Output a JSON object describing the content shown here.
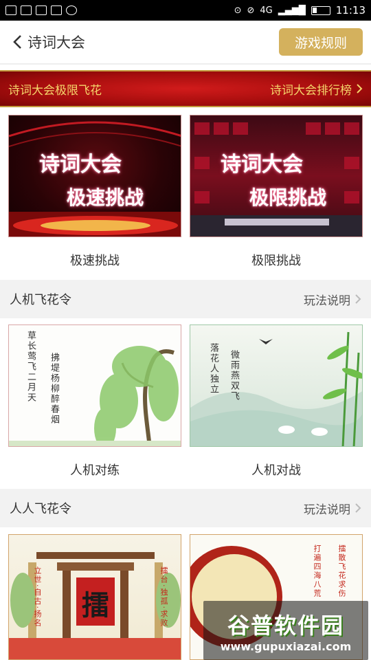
{
  "status_bar": {
    "network": "4G",
    "time": "11:13"
  },
  "header": {
    "title": "诗词大会",
    "rules_button": "游戏规则"
  },
  "banner": {
    "left": "诗词大会极限飞花",
    "right": "诗词大会排行榜"
  },
  "challenges": [
    {
      "poster_title": "诗词大会",
      "poster_sub": "极速挑战",
      "label": "极速挑战"
    },
    {
      "poster_title": "诗词大会",
      "poster_sub": "极限挑战",
      "label": "极限挑战"
    }
  ],
  "section_ai": {
    "title": "人机飞花令",
    "link": "玩法说明",
    "cards": [
      {
        "label": "人机对练",
        "poem_col1": "草长莺飞二月天",
        "poem_col2": "拂堤杨柳醉春烟"
      },
      {
        "label": "人机对战",
        "poem_col1": "落花人独立",
        "poem_col2": "微雨燕双飞"
      }
    ]
  },
  "section_pvp": {
    "title": "人人飞花令",
    "link": "玩法说明",
    "cards": [
      {
        "poster_char": "擂",
        "poem_col1": "立世·自古·扬名",
        "poem_col2": "擂台·独孤·求败"
      },
      {
        "poem_col1": "打遍四海八荒",
        "poem_col2": "擂散飞花求伤"
      }
    ]
  },
  "watermark": {
    "title": "谷普软件园",
    "url": "www.gupuxiazai.com"
  }
}
